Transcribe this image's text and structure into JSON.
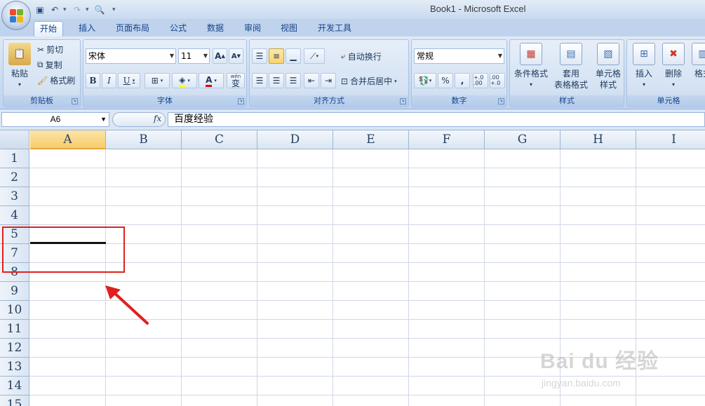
{
  "window": {
    "title": "Book1 - Microsoft Excel"
  },
  "tabs": [
    {
      "label": "开始",
      "active": true
    },
    {
      "label": "插入"
    },
    {
      "label": "页面布局"
    },
    {
      "label": "公式"
    },
    {
      "label": "数据"
    },
    {
      "label": "审阅"
    },
    {
      "label": "视图"
    },
    {
      "label": "开发工具"
    }
  ],
  "clipboard": {
    "paste": "粘贴",
    "cut": "剪切",
    "copy": "复制",
    "format_painter": "格式刷",
    "label": "剪贴板"
  },
  "font": {
    "name": "宋体",
    "size": "11",
    "bold": "B",
    "italic": "I",
    "underline": "U",
    "label": "字体",
    "grow": "A",
    "shrink": "A",
    "font_color": "A",
    "phonetic": "wén",
    "phonetic_main": "变"
  },
  "alignment": {
    "wrap": "自动换行",
    "merge": "合并后居中",
    "label": "对齐方式"
  },
  "number": {
    "format": "常规",
    "percent": "%",
    "comma": ",",
    "label": "数字",
    "inc_decimal": "+.0 .00",
    "dec_decimal": ".00 +.0"
  },
  "styles": {
    "conditional": "条件格式",
    "table_line1": "套用",
    "table_line2": "表格格式",
    "cell_styles_line1": "单元格",
    "cell_styles_line2": "样式",
    "label": "样式"
  },
  "cells": {
    "insert": "插入",
    "delete": "删除",
    "format": "格式",
    "label": "单元格"
  },
  "formula_bar": {
    "name_box": "A6",
    "fx": "fx",
    "content": "百度经验"
  },
  "columns": [
    "A",
    "B",
    "C",
    "D",
    "E",
    "F",
    "G",
    "H",
    "I"
  ],
  "rows": [
    "1",
    "2",
    "3",
    "4",
    "5",
    "7",
    "8",
    "9",
    "10",
    "11",
    "12",
    "13",
    "14",
    "15"
  ],
  "selected_column": "A",
  "watermark": {
    "main": "Bai du 经验",
    "sub": "jingyan.baidu.com"
  },
  "colors": {
    "accent_red": "#e02020",
    "header_selected": "#f8cd6c"
  }
}
